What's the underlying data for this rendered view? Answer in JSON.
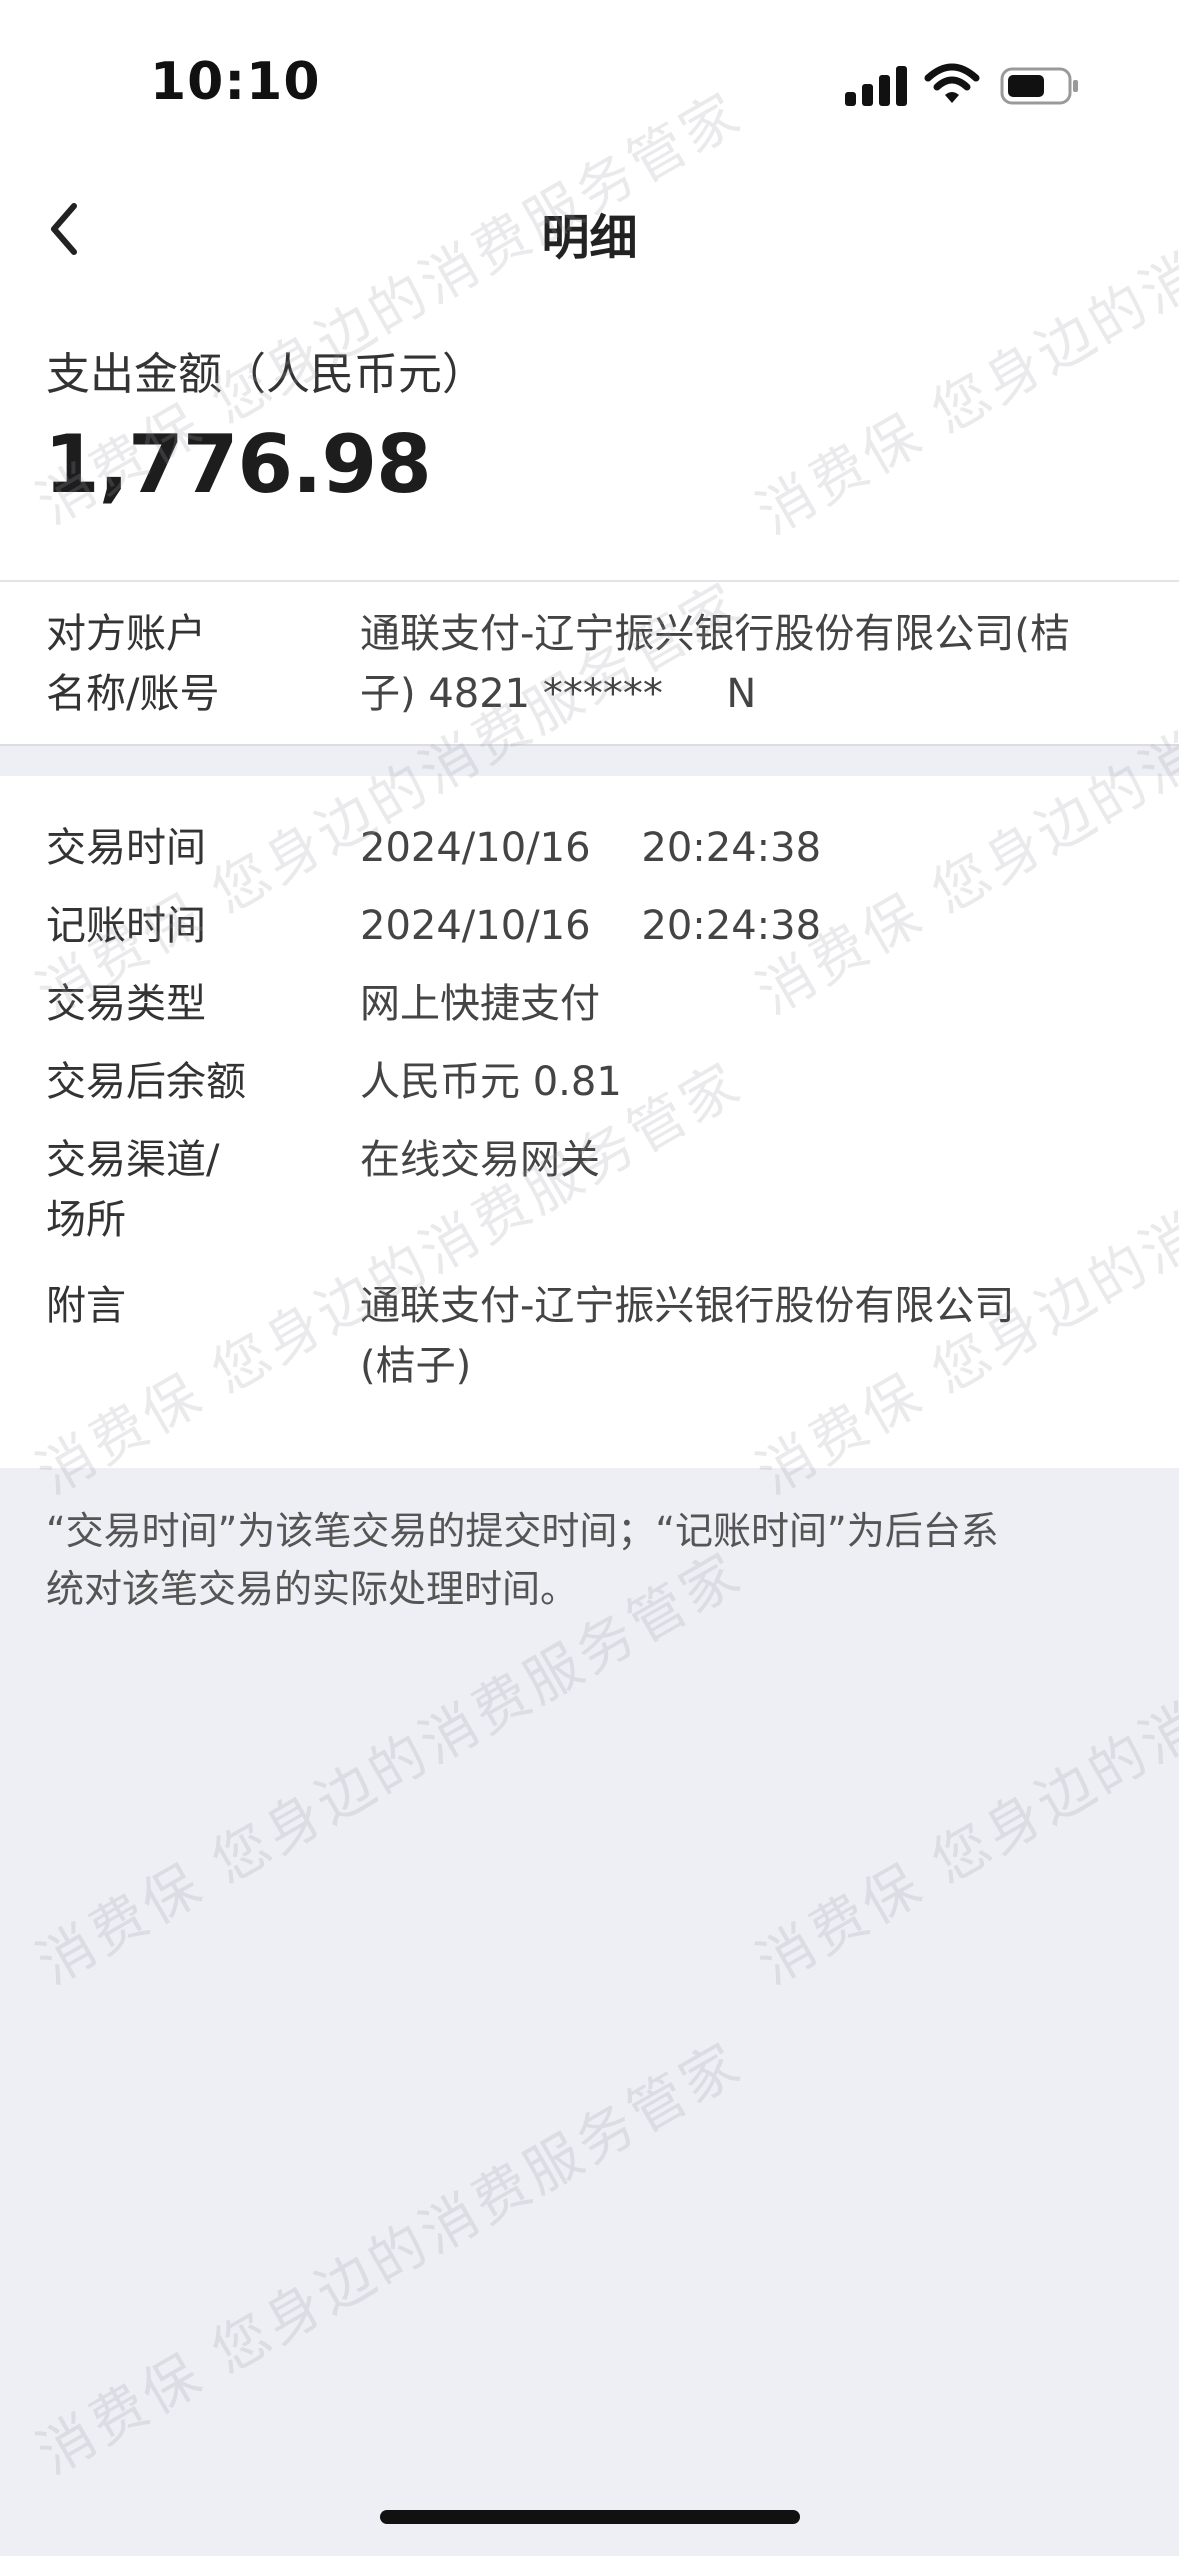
{
  "status_bar": {
    "time": "10:10"
  },
  "nav": {
    "title": "明细",
    "back_icon": "chevron-left-icon"
  },
  "amount": {
    "label": "支出金额（人民币元）",
    "value": "1,776.98"
  },
  "account": {
    "label_line1": "对方账户",
    "label_line2": "名称/账号",
    "value_line1": "通联支付-辽宁振兴银行股份有限公司(桔",
    "value_line2": "子) 4821 ******     N"
  },
  "details": [
    {
      "label": "交易时间",
      "value": "2024/10/16    20:24:38"
    },
    {
      "label": "记账时间",
      "value": "2024/10/16    20:24:38"
    },
    {
      "label": "交易类型",
      "value": "网上快捷支付"
    },
    {
      "label": "交易后余额",
      "value": "人民币元 0.81"
    },
    {
      "label_line1": "交易渠道/",
      "label_line2": "场所",
      "value": "在线交易网关"
    },
    {
      "label": "附言",
      "value_line1": "通联支付-辽宁振兴银行股份有限公司",
      "value_line2": "(桔子)"
    }
  ],
  "footnote": {
    "line1": "“交易时间”为该笔交易的提交时间；“记账时间”为后台系",
    "line2": "统对该笔交易的实际处理时间。"
  },
  "watermark": {
    "text": "消费保 您身边的消费服务管家"
  }
}
